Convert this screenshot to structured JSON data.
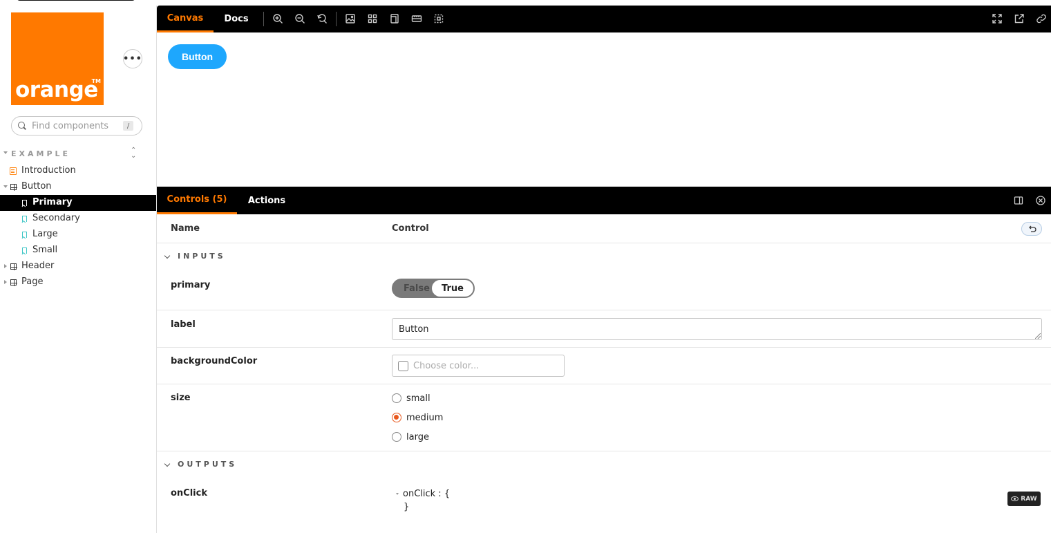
{
  "brand": {
    "name": "orange",
    "trademark": "TM",
    "color": "#ff7900"
  },
  "sidebar": {
    "search_placeholder": "Find components",
    "search_shortcut": "/",
    "group_label": "EXAMPLE",
    "items": [
      {
        "label": "Introduction",
        "kind": "doc"
      },
      {
        "label": "Button",
        "kind": "component",
        "expanded": true
      },
      {
        "label": "Primary",
        "kind": "story",
        "selected": true
      },
      {
        "label": "Secondary",
        "kind": "story"
      },
      {
        "label": "Large",
        "kind": "story"
      },
      {
        "label": "Small",
        "kind": "story"
      },
      {
        "label": "Header",
        "kind": "component",
        "expanded": false
      },
      {
        "label": "Page",
        "kind": "component",
        "expanded": false
      }
    ]
  },
  "toolbar": {
    "tabs": [
      "Canvas",
      "Docs"
    ],
    "active_tab": "Canvas",
    "tools": [
      "zoom-in-icon",
      "zoom-out-icon",
      "reset-zoom-icon",
      "background-icon",
      "grid-icon",
      "viewport-icon",
      "measure-icon",
      "outline-icon"
    ],
    "right_tools": [
      "fullscreen-icon",
      "open-new-tab-icon",
      "copy-link-icon"
    ]
  },
  "canvas": {
    "button_label": "Button",
    "button_color": "#1ea7fd"
  },
  "addons": {
    "tabs": [
      "Controls (5)",
      "Actions"
    ],
    "active_tab": "Controls (5)"
  },
  "controls": {
    "col_name": "Name",
    "col_control": "Control",
    "section_inputs": "INPUTS",
    "section_outputs": "OUTPUTS",
    "primary": {
      "name": "primary",
      "off": "False",
      "on": "True"
    },
    "label": {
      "name": "label",
      "value": "Button"
    },
    "backgroundColor": {
      "name": "backgroundColor",
      "placeholder": "Choose color..."
    },
    "size": {
      "name": "size",
      "options": [
        "small",
        "medium",
        "large"
      ],
      "selected": "medium"
    },
    "onClick": {
      "name": "onClick",
      "line1": "onClick : {",
      "line2": "}",
      "raw_label": "RAW"
    }
  },
  "colors": {
    "accent": "#ff7900",
    "radio_checked": "#e8581d"
  }
}
